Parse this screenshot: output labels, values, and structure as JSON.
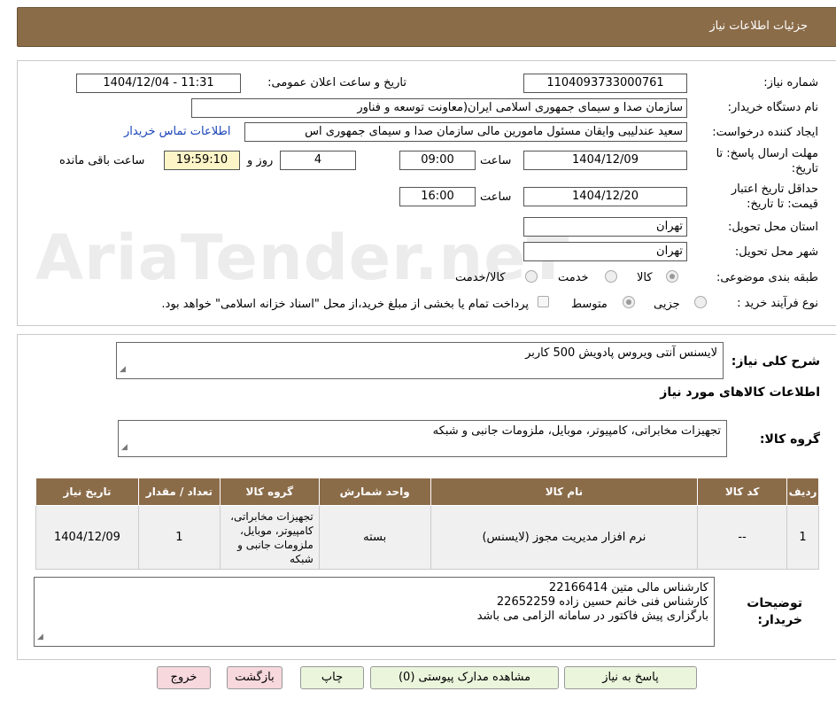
{
  "header": {
    "title": "جزئیات اطلاعات نیاز"
  },
  "watermark": "AriaTender.neT",
  "form": {
    "need_number_label": "شماره نیاز:",
    "need_number": "1104093733000761",
    "announce_label": "تاریخ و ساعت اعلان عمومی:",
    "announce_value": "1404/12/04 - 11:31",
    "buyer_org_label": "نام دستگاه خریدار:",
    "buyer_org": "سازمان صدا و سیمای جمهوری اسلامی ایران(معاونت توسعه و فناور",
    "requester_label": "ایجاد کننده درخواست:",
    "requester": "سعید عندلیبی وایقان مسئول مامورین مالی  سازمان صدا و سیمای جمهوری اس",
    "contact_link": "اطلاعات تماس خریدار",
    "deadline_label_1": "مهلت ارسال پاسخ: تا",
    "deadline_label_2": "تاریخ:",
    "deadline_date": "1404/12/09",
    "time_label": "ساعت",
    "deadline_time": "09:00",
    "days_value": "4",
    "days_label": "روز و",
    "remaining_time": "19:59:10",
    "remaining_label": "ساعت باقی مانده",
    "validity_label_1": "حداقل تاریخ اعتبار",
    "validity_label_2": "قیمت: تا تاریخ:",
    "validity_date": "1404/12/20",
    "validity_time": "16:00",
    "province_label": "استان محل تحویل:",
    "province": "تهران",
    "city_label": "شهر محل تحویل:",
    "city": "تهران",
    "category_label": "طبقه بندی موضوعی:",
    "category_options": [
      "کالا",
      "خدمت",
      "کالا/خدمت"
    ],
    "process_label": "نوع فرآیند خرید :",
    "process_options": [
      "جزیی",
      "متوسط"
    ],
    "payment_note": "پرداخت تمام یا بخشی از مبلغ خرید،از محل \"اسناد خزانه اسلامی\" خواهد بود."
  },
  "details": {
    "summary_label": "شرح کلی نیاز:",
    "summary": "لایسنس آنتی ویروس پادویش 500 کاربر",
    "goods_info_title": "اطلاعات کالاهای مورد نیاز",
    "goods_group_label": "گروه کالا:",
    "goods_group": "تجهیزات مخابراتی، کامپیوتر، موبایل، ملزومات جانبی و شبکه",
    "table": {
      "headers": [
        "ردیف",
        "کد کالا",
        "نام کالا",
        "واحد شمارش",
        "گروه کالا",
        "تعداد / مقدار",
        "تاریخ نیاز"
      ],
      "rows": [
        [
          "1",
          "--",
          "نرم افزار مدیریت مجوز (لایسنس)",
          "بسته",
          "تجهیزات مخابراتی، کامپیوتر، موبایل، ملزومات جانبی و شبکه",
          "1",
          "1404/12/09"
        ]
      ]
    },
    "buyer_notes_label_1": "توضیحات",
    "buyer_notes_label_2": "خریدار:",
    "buyer_notes": [
      "کارشناس مالی متین 22166414",
      "کارشناس فنی خانم حسین زاده 22652259",
      "بارگزاری پیش فاکتور در سامانه الزامی می باشد"
    ]
  },
  "buttons": {
    "reply": "پاسخ به نیاز",
    "attachments": "مشاهده مدارک پیوستی (0)",
    "print": "چاپ",
    "back": "بازگشت",
    "exit": "خروج"
  }
}
